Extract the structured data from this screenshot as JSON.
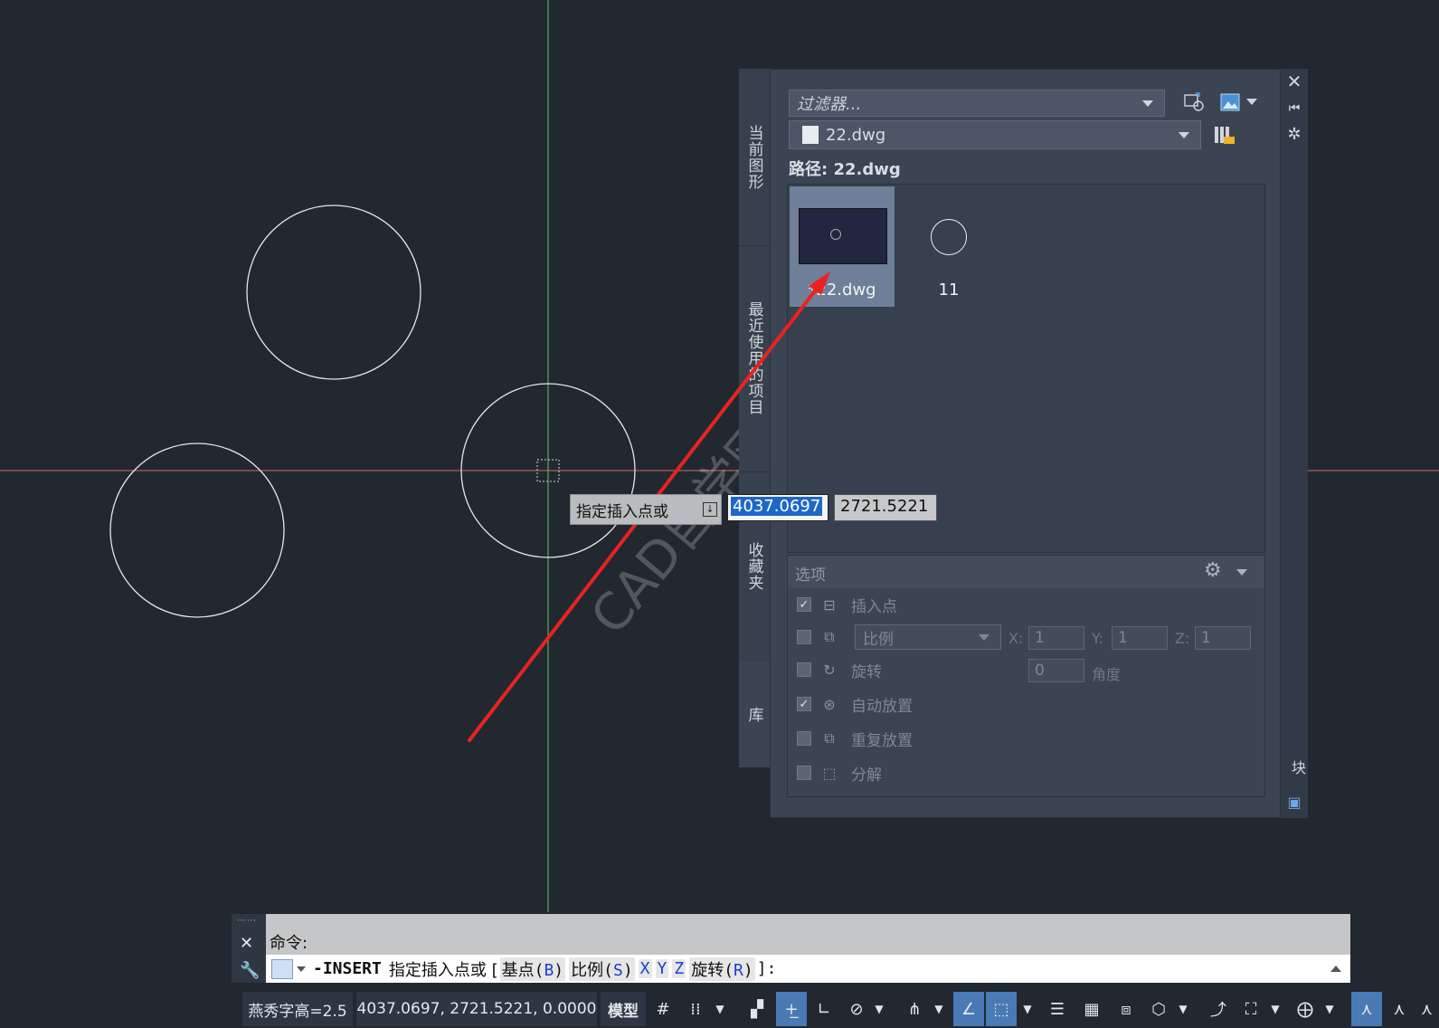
{
  "palette": {
    "tabs": [
      "当前图形",
      "最近使用的项目",
      "收藏夹",
      "库"
    ],
    "filter_placeholder": "过滤器...",
    "file_combo": "22.dwg",
    "path_label": "路径: 22.dwg",
    "thumbnails": [
      {
        "label": "*22.dwg",
        "selected": true
      },
      {
        "label": "11",
        "selected": false
      }
    ],
    "options": {
      "title": "选项",
      "insert_point": {
        "label": "插入点",
        "checked": true
      },
      "scale": {
        "dropdown": "比例",
        "checked": false,
        "x_label": "X:",
        "x": "1",
        "y_label": "Y:",
        "y": "1",
        "z_label": "Z:",
        "z": "1"
      },
      "rotate": {
        "label": "旋转",
        "checked": false,
        "angle": "0",
        "angle_label": "角度"
      },
      "auto_place": {
        "label": "自动放置",
        "checked": true
      },
      "repeat_place": {
        "label": "重复放置",
        "checked": false
      },
      "explode": {
        "label": "分解",
        "checked": false
      }
    },
    "side_label": "块"
  },
  "dynamic_input": {
    "prompt": "指定插入点或",
    "x_value": "4037.0697",
    "y_value": "2721.5221"
  },
  "watermark": "CAD自学网 www.cadzxw.com",
  "command": {
    "history": "命令:",
    "cmd": "-INSERT",
    "prompt": "指定插入点或 [",
    "opt1": "基点",
    "opt1_key": "B",
    "opt2": "比例",
    "opt2_key": "S",
    "opt3": "X",
    "opt4": "Y",
    "opt5": "Z",
    "opt6": "旋转",
    "opt6_key": "R",
    "tail": "]:"
  },
  "status": {
    "text_style": "燕秀字高=2.5",
    "coords": "4037.0697, 2721.5221, 0.0000",
    "model": "模型"
  },
  "colors": {
    "canvas_bg": "#212830",
    "crosshair_x": "#d46a6a",
    "crosshair_y": "#63c463",
    "accent": "#3f6ea8",
    "arrow": "#e8231e"
  }
}
